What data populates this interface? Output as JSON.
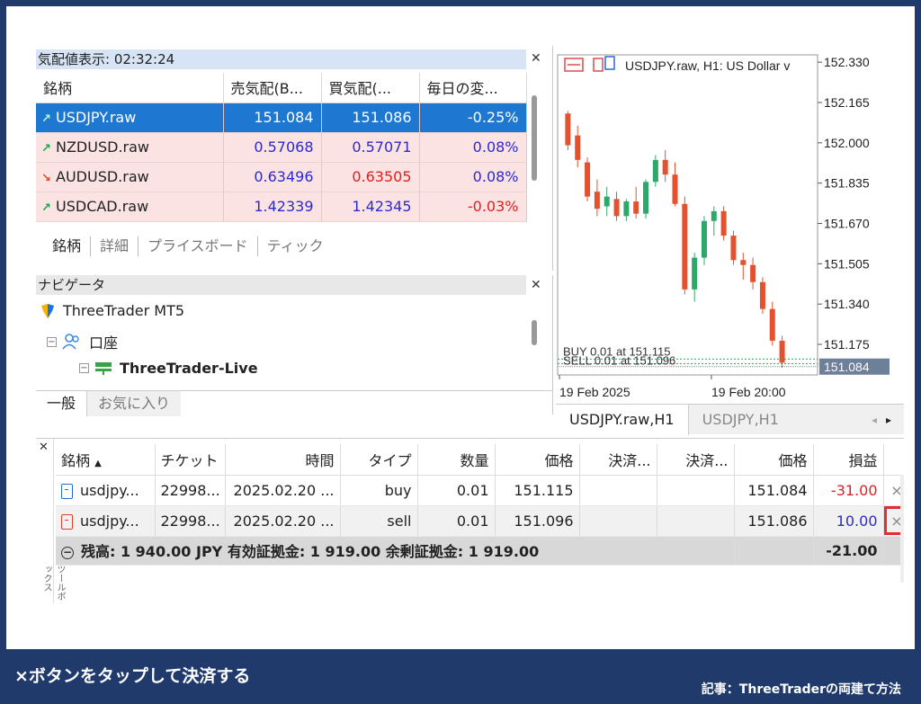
{
  "market_watch": {
    "title": "気配値表示: 02:32:24",
    "columns": [
      "銘柄",
      "売気配(B...",
      "買気配(...",
      "毎日の変..."
    ],
    "rows": [
      {
        "symbol": "USDJPY.raw",
        "trend": "up",
        "bid": "151.084",
        "ask": "151.086",
        "change": "-0.25%",
        "selected": true
      },
      {
        "symbol": "NZDUSD.raw",
        "trend": "up",
        "bid": "0.57068",
        "ask": "0.57071",
        "change": "0.08%"
      },
      {
        "symbol": "AUDUSD.raw",
        "trend": "down",
        "bid": "0.63496",
        "ask": "0.63505",
        "change": "0.08%"
      },
      {
        "symbol": "USDCAD.raw",
        "trend": "up",
        "bid": "1.42339",
        "ask": "1.42345",
        "change": "-0.03%"
      }
    ],
    "tabs": [
      "銘柄",
      "詳細",
      "プライスボード",
      "ティック"
    ]
  },
  "navigator": {
    "title": "ナビゲータ",
    "root": "ThreeTrader MT5",
    "accounts_label": "口座",
    "account_name": "ThreeTrader-Live",
    "tabs": [
      "一般",
      "お気に入り"
    ]
  },
  "chart": {
    "header_text": "USDJPY.raw, H1:  US Dollar v",
    "buy_line_label": "BUY 0.01 at 151.115",
    "sell_line_label": "SELL 0.01 at 151.096",
    "current_price": "151.084",
    "tabs": [
      "USDJPY.raw,H1",
      "USDJPY,H1"
    ]
  },
  "chart_data": {
    "type": "candlestick",
    "title": "USDJPY.raw, H1",
    "y_ticks": [
      "152.330",
      "152.165",
      "152.000",
      "151.835",
      "151.670",
      "151.505",
      "151.340",
      "151.175"
    ],
    "x_ticks": [
      "19 Feb 2025",
      "19 Feb 20:00"
    ],
    "ylim": [
      151.05,
      152.36
    ],
    "lines": {
      "buy": 151.115,
      "sell": 151.096,
      "current": 151.084
    },
    "candles": [
      {
        "o": 152.12,
        "h": 152.13,
        "l": 151.97,
        "c": 151.99
      },
      {
        "o": 152.03,
        "h": 152.07,
        "l": 151.9,
        "c": 151.93
      },
      {
        "o": 151.92,
        "h": 151.94,
        "l": 151.76,
        "c": 151.78
      },
      {
        "o": 151.8,
        "h": 151.85,
        "l": 151.7,
        "c": 151.73
      },
      {
        "o": 151.74,
        "h": 151.82,
        "l": 151.7,
        "c": 151.78
      },
      {
        "o": 151.77,
        "h": 151.8,
        "l": 151.68,
        "c": 151.7
      },
      {
        "o": 151.7,
        "h": 151.77,
        "l": 151.68,
        "c": 151.76
      },
      {
        "o": 151.76,
        "h": 151.82,
        "l": 151.69,
        "c": 151.71
      },
      {
        "o": 151.71,
        "h": 151.85,
        "l": 151.69,
        "c": 151.84
      },
      {
        "o": 151.84,
        "h": 151.95,
        "l": 151.82,
        "c": 151.93
      },
      {
        "o": 151.93,
        "h": 151.97,
        "l": 151.84,
        "c": 151.87
      },
      {
        "o": 151.87,
        "h": 151.92,
        "l": 151.74,
        "c": 151.75
      },
      {
        "o": 151.75,
        "h": 151.78,
        "l": 151.38,
        "c": 151.4
      },
      {
        "o": 151.4,
        "h": 151.55,
        "l": 151.35,
        "c": 151.53
      },
      {
        "o": 151.53,
        "h": 151.7,
        "l": 151.5,
        "c": 151.68
      },
      {
        "o": 151.68,
        "h": 151.74,
        "l": 151.62,
        "c": 151.72
      },
      {
        "o": 151.72,
        "h": 151.74,
        "l": 151.6,
        "c": 151.62
      },
      {
        "o": 151.62,
        "h": 151.64,
        "l": 151.5,
        "c": 151.52
      },
      {
        "o": 151.52,
        "h": 151.55,
        "l": 151.44,
        "c": 151.5
      },
      {
        "o": 151.5,
        "h": 151.53,
        "l": 151.4,
        "c": 151.43
      },
      {
        "o": 151.43,
        "h": 151.45,
        "l": 151.3,
        "c": 151.32
      },
      {
        "o": 151.32,
        "h": 151.35,
        "l": 151.17,
        "c": 151.19
      },
      {
        "o": 151.19,
        "h": 151.21,
        "l": 151.08,
        "c": 151.1
      }
    ]
  },
  "toolbox": {
    "side_label": "ツールボックス",
    "columns": [
      "銘柄",
      "チケット",
      "時間",
      "タイプ",
      "数量",
      "価格",
      "決済...",
      "決済...",
      "価格",
      "損益"
    ],
    "positions": [
      {
        "symbol": "usdjpy...",
        "ticket": "22998...",
        "time": "2025.02.20 ...",
        "type": "buy",
        "volume": "0.01",
        "open_price": "151.115",
        "sl": "",
        "tp": "",
        "price": "151.084",
        "profit": "-31.00"
      },
      {
        "symbol": "usdjpy...",
        "ticket": "22998...",
        "time": "2025.02.20 ...",
        "type": "sell",
        "volume": "0.01",
        "open_price": "151.096",
        "sl": "",
        "tp": "",
        "price": "151.086",
        "profit": "10.00"
      }
    ],
    "close_symbol": "×",
    "balance_text": "残高: 1 940.00 JPY  有効証拠金: 1 919.00  余剰証拠金: 1 919.00",
    "total_profit": "-21.00"
  },
  "caption": {
    "text": "×ボタンをタップして決済する",
    "credit": "記事：ThreeTraderの両建て方法"
  },
  "colors": {
    "frame_bg": "#1f3a6b",
    "selected_row": "#1e78d2",
    "row_tint": "#fbe3e3",
    "bull": "#2ea86a",
    "bear": "#e5512e",
    "highlight": "#e02d2d"
  }
}
